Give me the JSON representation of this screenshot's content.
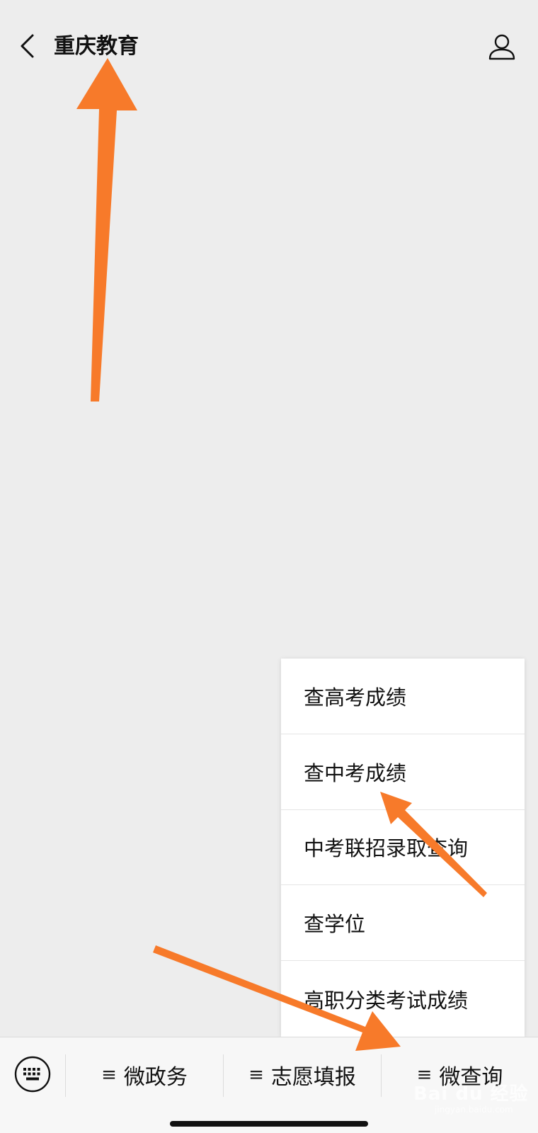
{
  "header": {
    "title": "重庆教育"
  },
  "menu_popup": {
    "items": [
      {
        "label": "查高考成绩"
      },
      {
        "label": "查中考成绩"
      },
      {
        "label": "中考联招录取查询"
      },
      {
        "label": "查学位"
      },
      {
        "label": "高职分类考试成绩"
      }
    ]
  },
  "bottom_menu": {
    "tabs": [
      {
        "label": "微政务"
      },
      {
        "label": "志愿填报"
      },
      {
        "label": "微查询"
      }
    ],
    "tab_glyph": "≡"
  },
  "watermark": {
    "text": "Bai du 经验",
    "sub": "jingyan.baidu.com"
  },
  "colors": {
    "background": "#ededed",
    "popup_background": "#ffffff",
    "annotation_arrow": "#f77a2a"
  },
  "icons": {
    "back": "chevron-left-icon",
    "profile": "person-icon",
    "keyboard": "keyboard-icon"
  }
}
